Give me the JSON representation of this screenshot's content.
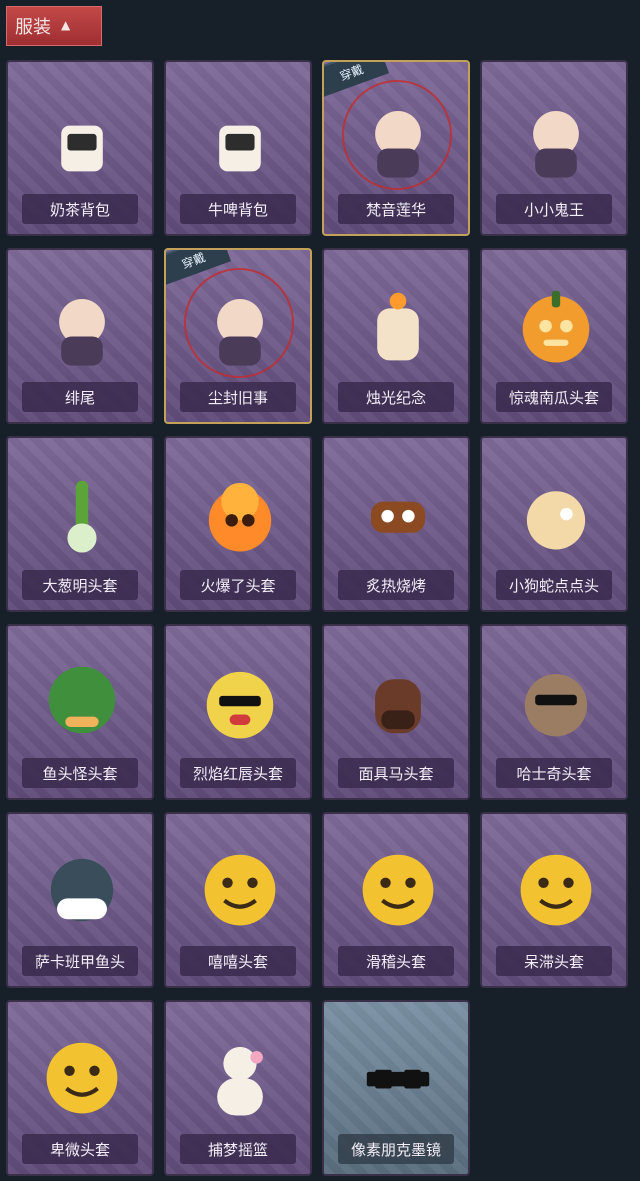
{
  "section": {
    "title": "服装",
    "toggle_icon": "chevron-up-icon"
  },
  "badge_text": "穿戴",
  "items": [
    {
      "label": "奶茶背包",
      "equipped": false,
      "icon": "milk-tea-backpack-icon"
    },
    {
      "label": "牛啤背包",
      "equipped": false,
      "icon": "cow-beer-backpack-icon"
    },
    {
      "label": "梵音莲华",
      "equipped": true,
      "icon": "lotus-character-icon"
    },
    {
      "label": "小小鬼王",
      "equipped": false,
      "icon": "little-ghost-king-icon"
    },
    {
      "label": "绯尾",
      "equipped": false,
      "icon": "fox-character-icon"
    },
    {
      "label": "尘封旧事",
      "equipped": true,
      "icon": "dusty-past-character-icon"
    },
    {
      "label": "烛光纪念",
      "equipped": false,
      "icon": "candle-icon"
    },
    {
      "label": "惊魂南瓜头套",
      "equipped": false,
      "icon": "pumpkin-head-icon"
    },
    {
      "label": "大葱明头套",
      "equipped": false,
      "icon": "scallion-head-icon"
    },
    {
      "label": "火爆了头套",
      "equipped": false,
      "icon": "fire-head-icon"
    },
    {
      "label": "炙热烧烤",
      "equipped": false,
      "icon": "bbq-meat-head-icon"
    },
    {
      "label": "小狗蛇点点头",
      "equipped": false,
      "icon": "puppy-snake-head-icon"
    },
    {
      "label": "鱼头怪头套",
      "equipped": false,
      "icon": "fishhead-mask-icon"
    },
    {
      "label": "烈焰红唇头套",
      "equipped": false,
      "icon": "pikachu-lips-mask-icon"
    },
    {
      "label": "面具马头套",
      "equipped": false,
      "icon": "horse-mask-icon"
    },
    {
      "label": "哈士奇头套",
      "equipped": false,
      "icon": "husky-mask-icon"
    },
    {
      "label": "萨卡班甲鱼头",
      "equipped": false,
      "icon": "sacabambaspis-head-icon"
    },
    {
      "label": "嘻嘻头套",
      "equipped": false,
      "icon": "grinning-emoji-head-icon"
    },
    {
      "label": "滑稽头套",
      "equipped": false,
      "icon": "smirk-emoji-head-icon"
    },
    {
      "label": "呆滞头套",
      "equipped": false,
      "icon": "stunned-emoji-head-icon"
    },
    {
      "label": "卑微头套",
      "equipped": false,
      "icon": "humble-emoji-head-icon"
    },
    {
      "label": "捕梦摇篮",
      "equipped": false,
      "icon": "dream-cradle-icon"
    },
    {
      "label": "像素朋克墨镜",
      "equipped": false,
      "icon": "pixel-sunglasses-icon"
    }
  ],
  "colors": {
    "background": "#172028",
    "card_purple": "#6e5a89",
    "card_blue": "#6c8293",
    "equipped_border": "#c4a15b",
    "header_red": "#b53c40"
  }
}
